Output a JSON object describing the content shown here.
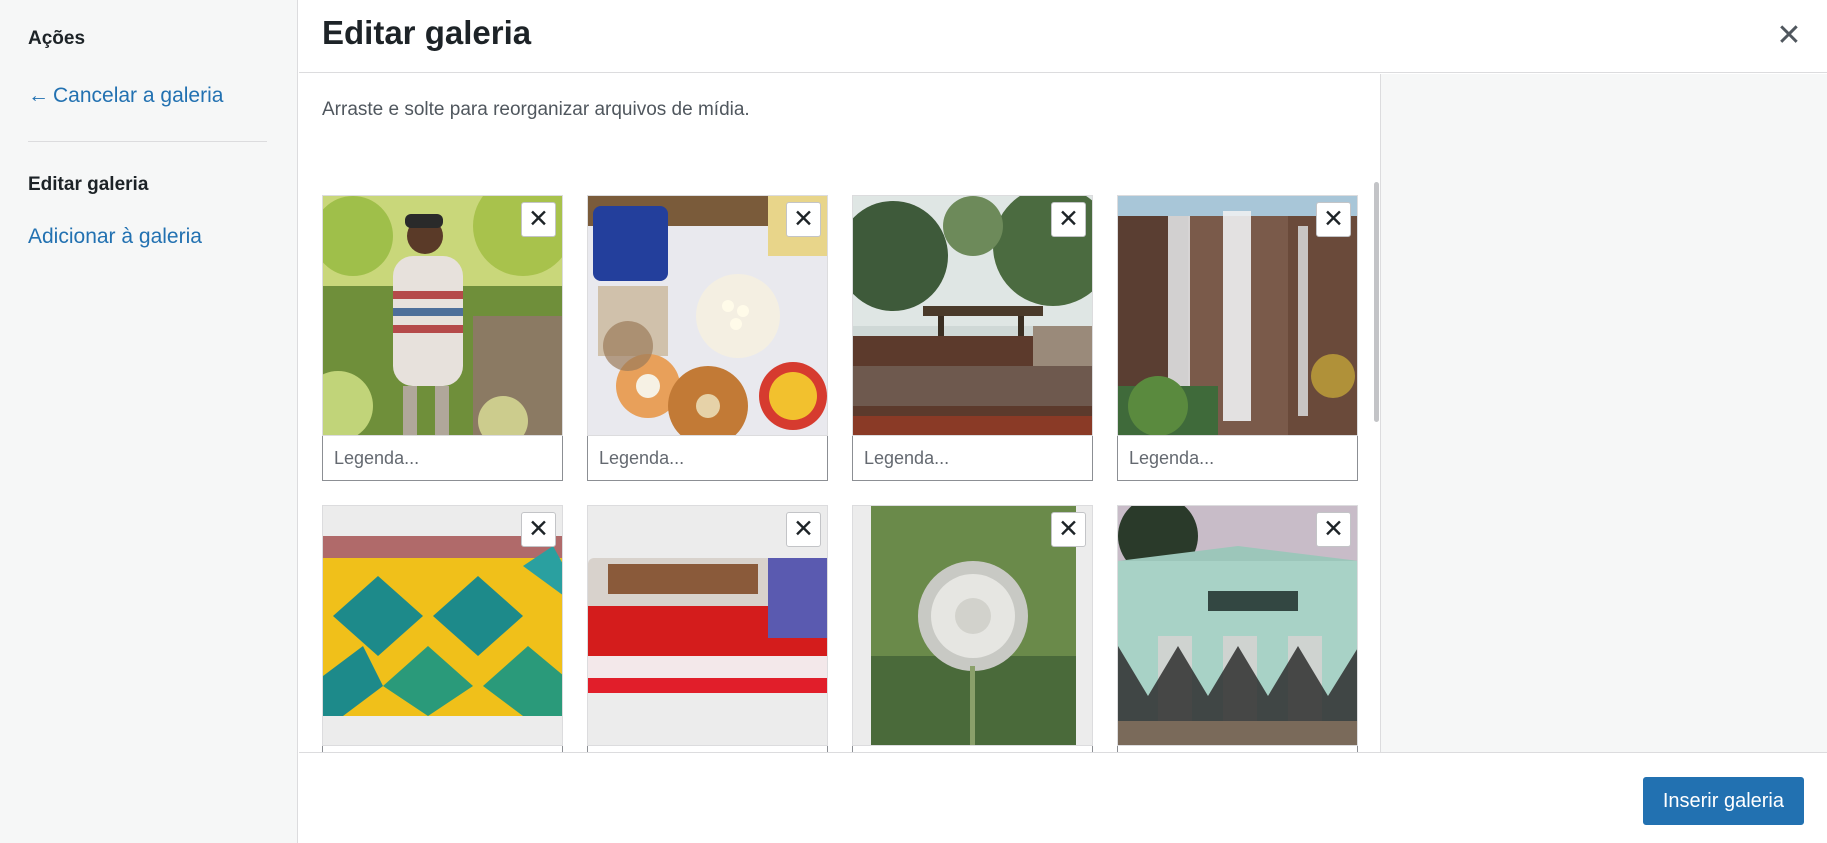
{
  "sidebar": {
    "actions_heading": "Ações",
    "cancel_arrow": "←",
    "cancel_label": "Cancelar a galeria",
    "edit_heading": "Editar galeria",
    "add_label": "Adicionar à galeria"
  },
  "header": {
    "title": "Editar galeria",
    "close_symbol": "✕"
  },
  "main": {
    "instructions": "Arraste e solte para reorganizar arquivos de mídia.",
    "remove_symbol": "✕",
    "caption_placeholder": "Legenda..."
  },
  "footer": {
    "insert_label": "Inserir galeria"
  },
  "colors": {
    "accent": "#2271b1",
    "sidebar_bg": "#f6f7f7",
    "border": "#dcdcde"
  }
}
